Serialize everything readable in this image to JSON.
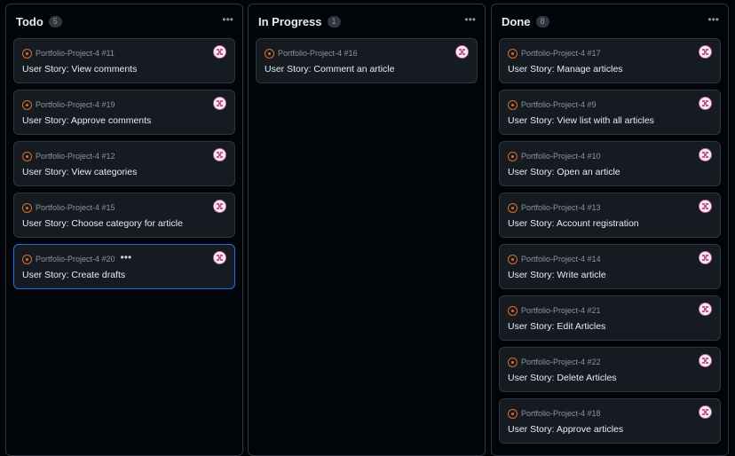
{
  "columns": [
    {
      "key": "todo",
      "title": "Todo",
      "count": "5",
      "cards": [
        {
          "ref": "Portfolio-Project-4 #11",
          "title": "User Story: View comments"
        },
        {
          "ref": "Portfolio-Project-4 #19",
          "title": "User Story: Approve comments"
        },
        {
          "ref": "Portfolio-Project-4 #12",
          "title": "User Story: View categories"
        },
        {
          "ref": "Portfolio-Project-4 #15",
          "title": "User Story: Choose category for article"
        },
        {
          "ref": "Portfolio-Project-4 #20",
          "title": "User Story: Create drafts",
          "selected": true
        }
      ]
    },
    {
      "key": "progress",
      "title": "In Progress",
      "count": "1",
      "cards": [
        {
          "ref": "Portfolio-Project-4 #16",
          "title": "User Story: Comment an article"
        }
      ]
    },
    {
      "key": "done",
      "title": "Done",
      "count": "8",
      "cards": [
        {
          "ref": "Portfolio-Project-4 #17",
          "title": "User Story: Manage articles"
        },
        {
          "ref": "Portfolio-Project-4 #9",
          "title": "User Story: View list with all articles"
        },
        {
          "ref": "Portfolio-Project-4 #10",
          "title": "User Story: Open an article"
        },
        {
          "ref": "Portfolio-Project-4 #13",
          "title": "User Story: Account registration"
        },
        {
          "ref": "Portfolio-Project-4 #14",
          "title": "User Story: Write article"
        },
        {
          "ref": "Portfolio-Project-4 #21",
          "title": "User Story: Edit Articles"
        },
        {
          "ref": "Portfolio-Project-4 #22",
          "title": "User Story: Delete Articles"
        },
        {
          "ref": "Portfolio-Project-4 #18",
          "title": "User Story: Approve articles"
        }
      ]
    }
  ],
  "icons": {
    "column_menu": "more-horizontal-icon",
    "card_status": "open-issue-icon",
    "assignee": "avatar-identicon"
  },
  "colors": {
    "background": "#010409",
    "card_background": "#161b22",
    "border": "#30363d",
    "issue_open": "#db6d28",
    "selected_border": "#1f6feb"
  }
}
